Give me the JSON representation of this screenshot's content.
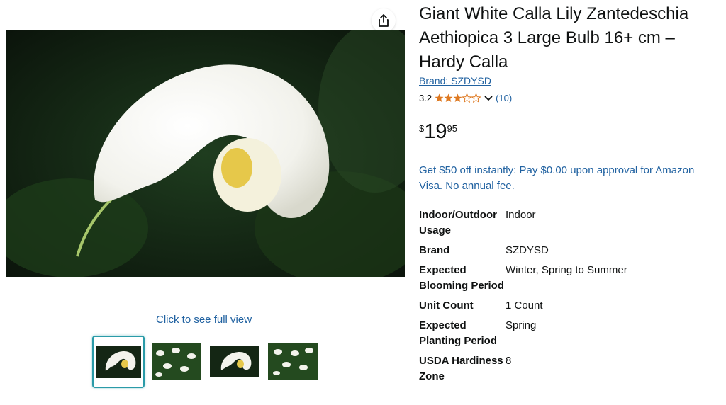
{
  "share": {
    "icon": "share-icon"
  },
  "gallery": {
    "see_full_view": "Click to see full view",
    "thumbnails": [
      {
        "name": "thumb-calla-closeup",
        "selected": true
      },
      {
        "name": "thumb-calla-garden",
        "selected": false
      },
      {
        "name": "thumb-calla-closeup-2",
        "selected": false
      },
      {
        "name": "thumb-calla-garden-2",
        "selected": false
      }
    ]
  },
  "product": {
    "title": "Giant White Calla Lily Zantedeschia Aethiopica 3 Large Bulb 16+ cm – Hardy Calla",
    "brand_link": "Brand: SZDYSD",
    "rating_value": "3.2",
    "rating_stars": 3.2,
    "rating_count": "(10)",
    "price": {
      "currency": "$",
      "whole": "19",
      "fraction": "95"
    },
    "promo": "Get $50 off instantly: Pay $0.00 upon approval for Amazon Visa. No annual fee.",
    "specs": [
      {
        "key": "Indoor/Outdoor Usage",
        "value": "Indoor"
      },
      {
        "key": "Brand",
        "value": "SZDYSD"
      },
      {
        "key": "Expected Blooming Period",
        "value": "Winter, Spring to Summer"
      },
      {
        "key": "Unit Count",
        "value": "1 Count"
      },
      {
        "key": "Expected Planting Period",
        "value": "Spring"
      },
      {
        "key": "USDA Hardiness Zone",
        "value": "8"
      }
    ]
  },
  "colors": {
    "link": "#2162a1",
    "star": "#de7921",
    "thumb_selected": "#2a9ba8"
  }
}
